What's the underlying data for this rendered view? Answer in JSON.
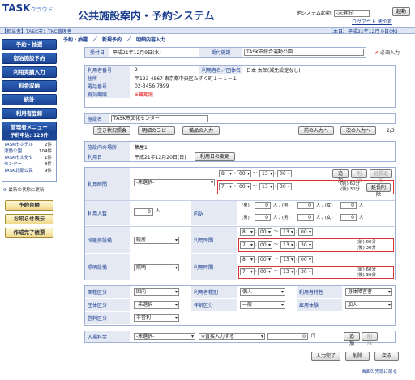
{
  "header": {
    "logo_main": "TASK",
    "logo_sub": "クラウド",
    "title": "公共施設案内・予約システム",
    "sys_label": "他システム起動:",
    "sys_value": "-未選択-",
    "start_btn": "起動",
    "links": "ログアウト 使の首"
  },
  "bar": {
    "left": "【担当者】TASK市：TKC管理者",
    "right": "【本日】平成21年12月 9日(水)"
  },
  "sidebar": {
    "items": [
      "予約・抽選",
      "宿泊施設予約",
      "利用実績入力",
      "料金収納",
      "統計",
      "利用者登録",
      "管理者メニュー"
    ],
    "list_title": "予約申込: 125件",
    "list": [
      {
        "name": "TASK市ホテル",
        "count": "2件"
      },
      {
        "name": "運動公園",
        "count": "104件"
      },
      {
        "name": "TASK市文化セ",
        "count": "1件"
      },
      {
        "name": "センター",
        "count": "8件"
      },
      {
        "name": "TASK北部公民",
        "count": "9件"
      }
    ],
    "refresh": "最新の状態に更新",
    "sub": [
      "予約台帳",
      "お知らせ表示",
      "作成完了帳票"
    ]
  },
  "breadcrumb": "予約・抽選　／　新規予約　／　明細内容入力",
  "required": "必須入力",
  "form": {
    "uketsuke_bi_label": "受付日",
    "uketsuke_bi": "平成21年12月9日(水)",
    "uketsuke_shisetsu_label": "受付施設",
    "uketsuke_shisetsu": "TASK市総合運動公園",
    "user_no_label": "利用者番号",
    "user_no": "2",
    "user_name_label": "利用者名／団体名",
    "user_name": "日本 太郎(減免設定なし)",
    "address_label": "住所",
    "address": "〒123-4567 東京都中央区たすく町１－１－１",
    "phone_label": "電話番号",
    "phone": "02-3456-7899",
    "valid_label": "有効期限",
    "valid": "※無期限",
    "facility_label": "施設名",
    "facility": "TASK市文化センター",
    "btn_vacancy": "空き状況照会",
    "btn_copy": "明細のコピー",
    "btn_equipment": "備品の入力",
    "btn_prev": "前の入力へ",
    "btn_next": "次の入力へ",
    "page": "2/3",
    "room_label": "施設内の場所",
    "room": "集屋1",
    "date_label": "利用日",
    "date": "平成21年12月20日(日)",
    "btn_change_date": "利用日の変更",
    "time_label": "利用時間",
    "purpose": "-未選択-",
    "btn_add": "追加",
    "btn_delete": "削除",
    "btn_ext_add": "延長追加",
    "btn_ext_del": "延長削除",
    "t1": {
      "sh": "8",
      "sm": "00",
      "eh": "13",
      "em": "00"
    },
    "t2": {
      "sh": "7",
      "sm": "00",
      "eh": "13",
      "em": "30"
    },
    "t2_note": "(前) 60分\n(後) 30分",
    "people_label": "利用人数",
    "people": "0",
    "people_unit": "人",
    "breakdown_label": "内訳",
    "bd1": "(男)",
    "bd1v": "0",
    "bd1u": "人 / (男)",
    "bd1v2": "0",
    "bd1u2": "人 / (女)",
    "bd1v3": "0",
    "bd1u3": "人",
    "bd2": "(男)",
    "bd2v": "0",
    "bd2u": "人 / (男)",
    "bd2v2": "0",
    "bd2u2": "人 / (女)",
    "bd2v3": "0",
    "bd2u3": "人",
    "hvac_label": "冷暖房設備",
    "hvac": "暖房",
    "lighting_label": "照明設備",
    "lighting": "照明",
    "hvac_t1": {
      "sh": "8",
      "sm": "00",
      "eh": "13",
      "em": "00"
    },
    "hvac_t2": {
      "sh": "7",
      "sm": "00",
      "eh": "13",
      "em": "30"
    },
    "light_t1": {
      "sh": "8",
      "sm": "00",
      "eh": "13",
      "em": "00"
    },
    "light_t2": {
      "sh": "7",
      "sm": "00",
      "eh": "13",
      "em": "30"
    },
    "tilde": "～",
    "colon": ":",
    "group_label": "團種区分",
    "group": "国内",
    "user_type_label": "利用者種別",
    "user_type": "個人",
    "user_trait_label": "利用者特性",
    "user_trait": "身体障害者",
    "org_label": "団体区分",
    "org": "-未選択-",
    "age_label": "年齢区分",
    "age": "一般",
    "employ_label": "雇用体験",
    "employ": "加入",
    "profit_label": "営利区分",
    "profit": "非営利",
    "fee_label": "入場料金",
    "fee_sel": "-未選択-",
    "fee_direct": "※直接入力する",
    "fee_val": "0",
    "fee_unit": "円",
    "btn_confirm": "入力完了",
    "btn_del": "削除",
    "btn_back": "戻る",
    "top_link": "画面の先頭に戻る"
  }
}
